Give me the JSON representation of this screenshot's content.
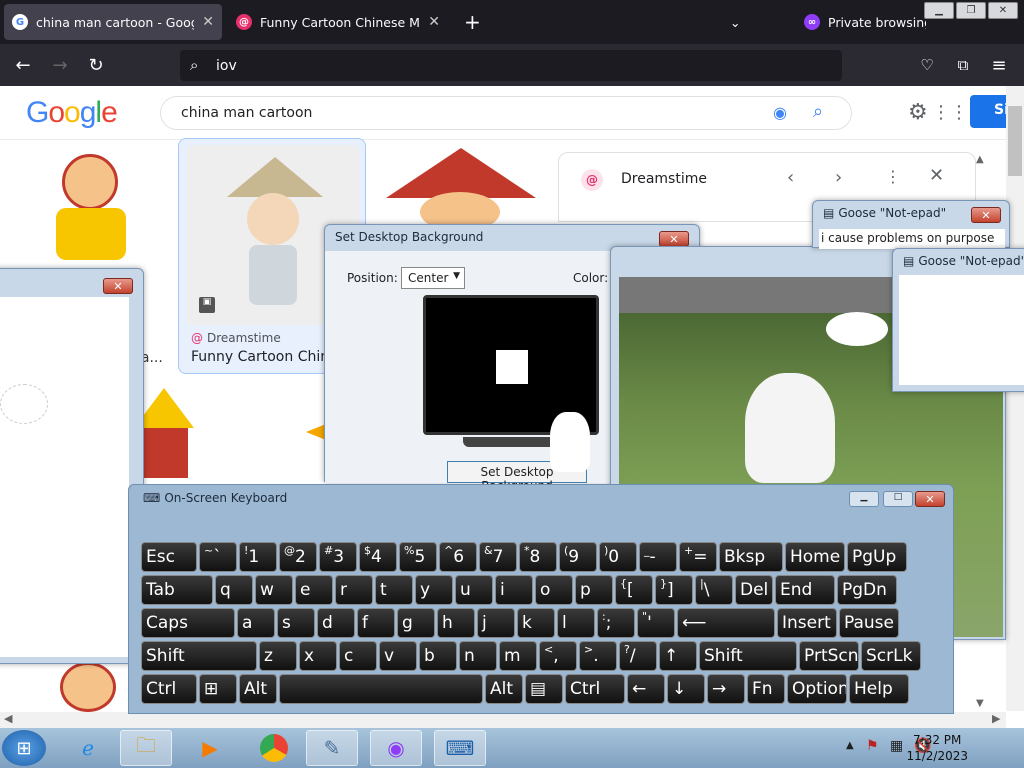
{
  "browser": {
    "tabs": [
      {
        "label": "china man cartoon - Google Se",
        "favicon": "google-icon"
      },
      {
        "label": "Funny Cartoon Chinese Man St",
        "favicon": "dreamstime-icon"
      }
    ],
    "new_tab": "+",
    "private_label": "Private browsing",
    "url": "iov"
  },
  "google": {
    "logo": "Google",
    "query": "china man cartoon",
    "signin": "Si",
    "results": [
      {
        "source": "Dreamstime",
        "title": "Funny Cartoon Chine"
      }
    ],
    "partial_caption": "na..."
  },
  "preview": {
    "source": "Dreamstime"
  },
  "desktop_bg": {
    "title": "Set Desktop Background",
    "position_label": "Position:",
    "position_value": "Center",
    "color_label": "Color:",
    "set_button": "Set Desktop Background"
  },
  "goose1": {
    "title": "Goose \"Not-epad\"",
    "text": "i cause problems on purpose"
  },
  "goose2": {
    "title": "Goose \"Not-epad\""
  },
  "osk": {
    "title": "On-Screen Keyboard",
    "rows": [
      [
        {
          "l": "Esc"
        },
        {
          "l": "` ",
          "s": "~"
        },
        {
          "l": "1",
          "s": "!"
        },
        {
          "l": "2",
          "s": "@"
        },
        {
          "l": "3",
          "s": "#"
        },
        {
          "l": "4",
          "s": "$"
        },
        {
          "l": "5",
          "s": "%"
        },
        {
          "l": "6",
          "s": "^"
        },
        {
          "l": "7",
          "s": "&"
        },
        {
          "l": "8",
          "s": "*"
        },
        {
          "l": "9",
          "s": "("
        },
        {
          "l": "0",
          "s": ")"
        },
        {
          "l": "-",
          "s": "_"
        },
        {
          "l": "=",
          "s": "+"
        },
        {
          "l": "Bksp"
        },
        {
          "l": "Home"
        },
        {
          "l": "PgUp"
        }
      ],
      [
        {
          "l": "Tab"
        },
        {
          "l": "q"
        },
        {
          "l": "w"
        },
        {
          "l": "e"
        },
        {
          "l": "r"
        },
        {
          "l": "t"
        },
        {
          "l": "y"
        },
        {
          "l": "u"
        },
        {
          "l": "i"
        },
        {
          "l": "o"
        },
        {
          "l": "p"
        },
        {
          "l": "[",
          "s": "{"
        },
        {
          "l": "]",
          "s": "}"
        },
        {
          "l": "\\",
          "s": "|"
        },
        {
          "l": "Del"
        },
        {
          "l": "End"
        },
        {
          "l": "PgDn"
        }
      ],
      [
        {
          "l": "Caps"
        },
        {
          "l": "a"
        },
        {
          "l": "s"
        },
        {
          "l": "d"
        },
        {
          "l": "f"
        },
        {
          "l": "g"
        },
        {
          "l": "h"
        },
        {
          "l": "j"
        },
        {
          "l": "k"
        },
        {
          "l": "l"
        },
        {
          "l": ";",
          "s": ":"
        },
        {
          "l": "'",
          "s": "\""
        },
        {
          "l": "⟵"
        },
        {
          "l": "Insert"
        },
        {
          "l": "Pause"
        }
      ],
      [
        {
          "l": "Shift"
        },
        {
          "l": "z"
        },
        {
          "l": "x"
        },
        {
          "l": "c"
        },
        {
          "l": "v"
        },
        {
          "l": "b"
        },
        {
          "l": "n"
        },
        {
          "l": "m"
        },
        {
          "l": ",",
          "s": "<"
        },
        {
          "l": ".",
          "s": ">"
        },
        {
          "l": "/",
          "s": "?"
        },
        {
          "l": "↑"
        },
        {
          "l": "Shift"
        },
        {
          "l": "PrtScn"
        },
        {
          "l": "ScrLk"
        }
      ],
      [
        {
          "l": "Ctrl"
        },
        {
          "l": "⊞"
        },
        {
          "l": "Alt"
        },
        {
          "l": ""
        },
        {
          "l": "Alt"
        },
        {
          "l": "▤"
        },
        {
          "l": "Ctrl"
        },
        {
          "l": "←"
        },
        {
          "l": "↓"
        },
        {
          "l": "→"
        },
        {
          "l": "Fn"
        },
        {
          "l": "Options"
        },
        {
          "l": "Help"
        }
      ]
    ]
  },
  "taskbar": {
    "time": "7:32 PM",
    "date": "11/2/2023"
  }
}
